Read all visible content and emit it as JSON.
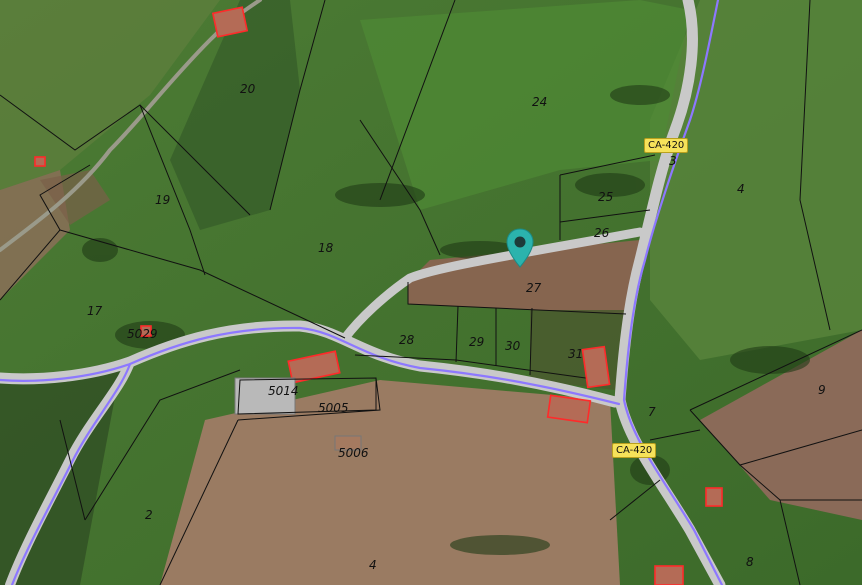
{
  "map": {
    "road_labels": [
      "CA-420",
      "CA-420"
    ],
    "parcels": [
      "24",
      "20",
      "19",
      "18",
      "17",
      "25",
      "26",
      "27",
      "28",
      "29",
      "30",
      "31",
      "4",
      "3",
      "9",
      "7",
      "8",
      "2",
      "4",
      "5029",
      "5014",
      "5005",
      "5006"
    ],
    "colors": {
      "road_line": "#8d78ff",
      "road_surface": "#c9c9c9",
      "parcel_line": "#111111",
      "building_outline": "#ff2a2a",
      "marker": "#2bb3ad",
      "road_badge": "#f6e25a"
    },
    "marker_icon": "map-pin-icon"
  }
}
